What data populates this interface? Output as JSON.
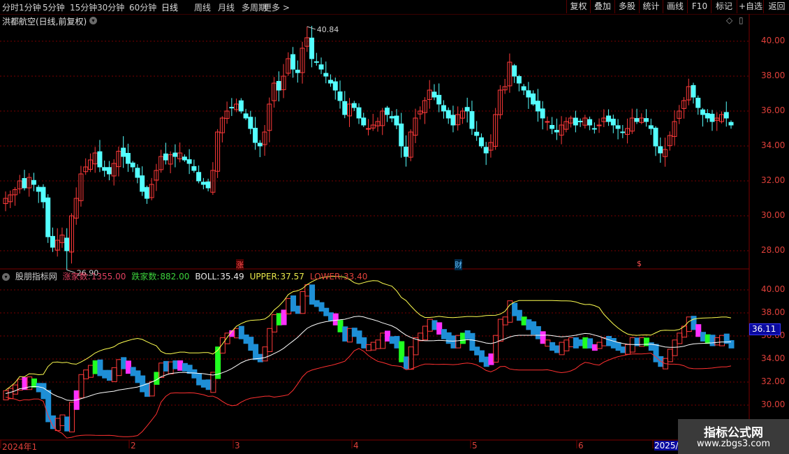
{
  "toolbar": {
    "periods": [
      "分时",
      "1分钟",
      "5分钟",
      "15分钟",
      "30分钟",
      "60分钟",
      "日线",
      "周线",
      "月线",
      "多周期",
      "更多 >"
    ],
    "active": "日线",
    "right_buttons": [
      "复权",
      "叠加",
      "多股",
      "统计",
      "画线",
      "F10",
      "+自选",
      "返回"
    ],
    "mark_label": "标记"
  },
  "stock": {
    "name": "洪都航空(日线,前复权)"
  },
  "price_axis": {
    "ticks": [
      "40.00",
      "38.00",
      "36.00",
      "34.00",
      "32.00",
      "30.00",
      "28.00"
    ]
  },
  "annotations": {
    "high": "40.84",
    "low": "26.90"
  },
  "events": [
    "涨",
    "财",
    "$"
  ],
  "indicator": {
    "name": "股朋指标网",
    "items": [
      {
        "label": "涨家数:",
        "value": "1355.00",
        "color": "#e04060"
      },
      {
        "label": "跌家数:",
        "value": "882.00",
        "color": "#3cd23c"
      },
      {
        "label": "BOLL:",
        "value": "35.49",
        "color": "#e8e8e8"
      },
      {
        "label": "UPPER:",
        "value": "37.57",
        "color": "#e8e84a"
      },
      {
        "label": "LOWER:",
        "value": "33.40",
        "color": "#e0403a"
      }
    ]
  },
  "ind_axis": {
    "ticks": [
      "40.00",
      "38.00",
      "36.00",
      "34.00",
      "32.00",
      "30.00"
    ]
  },
  "current_price": "36.11",
  "date_axis": {
    "labels": [
      "2024年1",
      "2",
      "3",
      "4",
      "5",
      "6",
      "2025/0"
    ]
  },
  "watermark": {
    "title": "指标公式网",
    "url": "www.zbgs3.com"
  },
  "colors": {
    "up": "#ff3a3a",
    "down": "#54ffff",
    "boll": "#ffffff",
    "upper": "#ffff50",
    "lower": "#ff3030",
    "grid": "#7a0000",
    "axis_text": "#e0403a",
    "mag": "#ff30ff",
    "grn": "#20ff20",
    "blu": "#1e8fd6"
  },
  "chart_data": {
    "type": "candlestick",
    "title": "洪都航空(日线,前复权)",
    "ylim": [
      26.5,
      41.5
    ],
    "high": 40.84,
    "low": 26.9,
    "closes": [
      31.0,
      31.2,
      31.5,
      32.0,
      31.6,
      32.2,
      31.8,
      31.4,
      30.8,
      28.8,
      28.2,
      28.6,
      28.9,
      28.0,
      30.0,
      31.0,
      32.4,
      32.8,
      33.2,
      33.6,
      32.8,
      32.6,
      32.4,
      33.0,
      33.7,
      33.4,
      33.0,
      32.8,
      32.2,
      31.4,
      31.0,
      31.8,
      32.6,
      33.4,
      33.2,
      33.5,
      33.4,
      33.6,
      33.2,
      33.0,
      32.6,
      32.0,
      31.8,
      31.6,
      32.6,
      34.8,
      35.6,
      36.0,
      36.2,
      36.4,
      36.0,
      35.6,
      35.0,
      34.2,
      34.0,
      34.8,
      36.4,
      37.6,
      37.2,
      38.0,
      39.0,
      38.4,
      38.2,
      39.6,
      40.2,
      39.0,
      38.8,
      38.4,
      38.0,
      37.6,
      37.2,
      36.6,
      35.8,
      36.4,
      36.2,
      35.6,
      35.2,
      35.0,
      35.2,
      35.4,
      36.0,
      35.8,
      35.6,
      35.2,
      34.0,
      33.4,
      34.8,
      35.6,
      36.0,
      36.6,
      37.2,
      36.8,
      36.4,
      36.0,
      35.6,
      35.2,
      35.8,
      36.0,
      36.0,
      35.0,
      34.6,
      34.0,
      33.6,
      34.2,
      35.8,
      37.2,
      37.4,
      38.8,
      38.0,
      37.6,
      37.2,
      36.8,
      36.4,
      36.0,
      35.6,
      35.4,
      35.0,
      34.8,
      35.2,
      35.4,
      35.6,
      35.2,
      35.4,
      35.6,
      35.2,
      35.0,
      35.2,
      35.6,
      35.4,
      35.2,
      35.0,
      34.8,
      35.0,
      35.6,
      35.4,
      35.6,
      35.4,
      35.0,
      34.0,
      33.6,
      33.8,
      34.6,
      35.4,
      36.0,
      36.6,
      37.4,
      36.8,
      36.2,
      35.8,
      35.6,
      35.4,
      35.6,
      35.8,
      35.6,
      35.2
    ],
    "boll": {
      "name": "BOLL",
      "last": 35.49
    },
    "upper": {
      "name": "UPPER",
      "last": 37.57
    },
    "lower": {
      "name": "LOWER",
      "last": 33.4
    },
    "advances": 1355.0,
    "declines": 882.0,
    "x_labels": [
      "2024年1",
      "2",
      "3",
      "4",
      "5",
      "6",
      "2025/0"
    ]
  }
}
